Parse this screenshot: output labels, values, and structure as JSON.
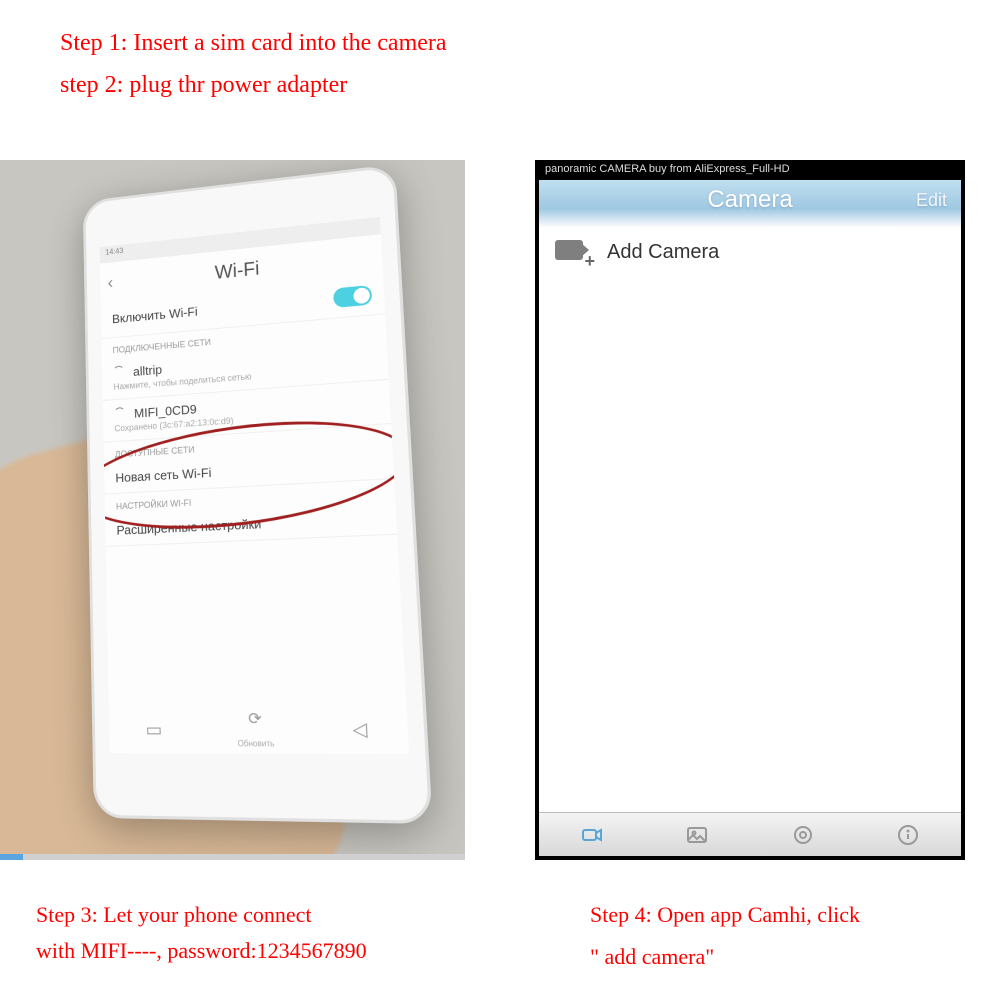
{
  "instructions": {
    "step1": "Step 1: Insert a sim card into the camera",
    "step2": "step 2: plug thr power adapter",
    "step3_line1": "Step 3: Let your phone connect",
    "step3_line2": "with MIFI----, password:1234567890",
    "step4_line1": "Step 4: Open app Camhi, click",
    "step4_line2": "\" add camera\""
  },
  "phone": {
    "status_time": "14:43",
    "screen_title": "Wi-Fi",
    "toggle_label": "Включить Wi-Fi",
    "section_connected": "ПОДКЛЮЧЕННЫЕ СЕТИ",
    "network1": "alltrip",
    "network1_sub": "Нажмите, чтобы поделиться сетью",
    "network2": "MIFI_0CD9",
    "network2_sub": "Сохранено (3c:67:a2:13:0c:d9)",
    "section_available": "ДОСТУПНЫЕ СЕТИ",
    "row_newnet": "Новая сеть Wi-Fi",
    "section_settings": "НАСТРОЙКИ WI-FI",
    "row_advanced": "Расширенные настройки",
    "refresh": "Обновить"
  },
  "app": {
    "video_caption": "panoramic CAMERA buy from AliExpress_Full-HD",
    "header_title": "Camera",
    "header_edit": "Edit",
    "add_camera": "Add Camera"
  }
}
